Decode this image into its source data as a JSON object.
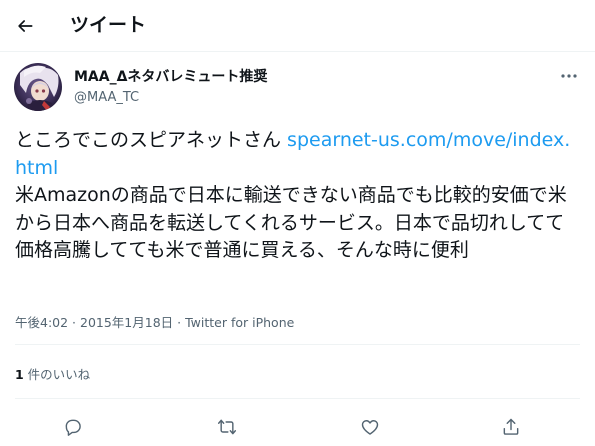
{
  "header": {
    "title": "ツイート",
    "back_icon": "arrow-left-icon"
  },
  "author": {
    "display_name": "MAA_Δネタバレミュート推奨",
    "handle": "@MAA_TC",
    "avatar_icon": "avatar-image"
  },
  "tweet": {
    "text_before_link": "ところでこのスピアネットさん ",
    "link_text": "spearnet-us.com/move/index.html",
    "text_after_link": "米Amazonの商品で日本に輸送できない商品でも比較的安価で米から日本へ商品を転送してくれるサービス。日本で品切れしてて価格高騰してても米で普通に買える、そんな時に便利",
    "timestamp": "午後4:02 · 2015年1月18日 · ",
    "source": "Twitter for iPhone"
  },
  "engagement": {
    "likes_count": "1",
    "likes_label": " 件のいいね"
  },
  "actions": [
    "reply-icon",
    "retweet-icon",
    "like-icon",
    "share-icon"
  ],
  "colors": {
    "text": "#0f1419",
    "secondary": "#536471",
    "link": "#1d9bf0",
    "divider": "#eff3f4"
  }
}
